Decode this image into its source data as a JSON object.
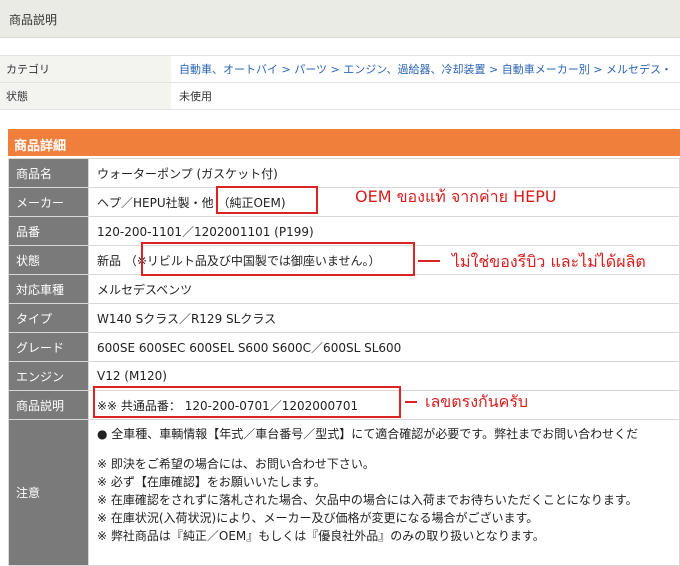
{
  "header": {
    "title": "商品説明"
  },
  "info": {
    "category_label": "カテゴリ",
    "category_path": "自動車、オートバイ > パーツ > エンジン、過給器、冷却装置 > 自動車メーカー別 > メルセデス・",
    "condition_label": "状態",
    "condition_value": "未使用"
  },
  "detail": {
    "heading": "商品詳細",
    "rows": [
      {
        "label": "商品名",
        "value": "ウォーターポンプ (ガスケット付)"
      },
      {
        "label": "メーカー",
        "value": "ヘプ／HEPU社製・他 （純正OEM)"
      },
      {
        "label": "品番",
        "value": "120-200-1101／1202001101 (P199)"
      },
      {
        "label": "状態",
        "value": "新品 （※リビルト品及び中国製では御座いません。）"
      },
      {
        "label": "対応車種",
        "value": "メルセデスベンツ"
      },
      {
        "label": "タイプ",
        "value": "W140 Sクラス／R129 SLクラス"
      },
      {
        "label": "グレード",
        "value": "600SE 600SEC 600SEL S600 S600C／600SL SL600"
      },
      {
        "label": "エンジン",
        "value": "V12 (M120)"
      },
      {
        "label": "商品説明",
        "value": "※※ 共通品番： 120-200-0701／1202000701"
      }
    ],
    "notes": {
      "label": "注意",
      "lines": [
        "● 全車種、車輌情報【年式／車台番号／型式】にて適合確認が必要です。弊社までお問い合わせくだ",
        "※ 即決をご希望の場合には、お問い合わせ下さい。",
        "※ 必ず【在庫確認】をお願いいたします。",
        "※ 在庫確認をされずに落札された場合、欠品中の場合には入荷までお待ちいただくことになります。",
        "※ 在庫状況(入荷状況)により、メーカー及び価格が変更になる場合がございます。",
        "※ 弊社商品は『純正／OEM』もしくは『優良社外品』のみの取り扱いとなります。"
      ]
    }
  },
  "annotations": {
    "oem_note": "OEM ของแท้ จากค่าย HEPU",
    "not_rebuilt_note": "ไม่ใช่ของรีบิว และไม่ได้ผลิต",
    "part_number_note": "เลขตรงกันครับ",
    "color": "#d22222"
  },
  "colors": {
    "accent_orange": "#f07f3c",
    "label_gray": "#7a7a7a",
    "link_blue": "#2a64b4"
  }
}
